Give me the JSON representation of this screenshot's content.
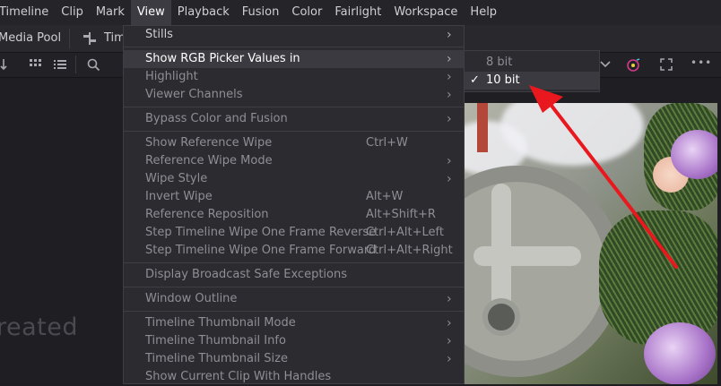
{
  "menubar": {
    "items": [
      "Timeline",
      "Clip",
      "Mark",
      "View",
      "Playback",
      "Fusion",
      "Color",
      "Fairlight",
      "Workspace",
      "Help"
    ],
    "active_index": 3
  },
  "toolbar1": {
    "media_pool_label": "Media Pool",
    "timeline_label_partial": "Tim"
  },
  "left_panel": {
    "empty_text_partial": "reated"
  },
  "view_menu": {
    "items": [
      {
        "label": "Stills",
        "shortcut": "",
        "submenu": true,
        "enabled": true
      },
      {
        "label": "Show RGB Picker Values in",
        "shortcut": "",
        "submenu": true,
        "enabled": true,
        "highlighted": true
      },
      {
        "label": "Highlight",
        "shortcut": "",
        "submenu": true,
        "enabled": false
      },
      {
        "label": "Viewer Channels",
        "shortcut": "",
        "submenu": true,
        "enabled": false
      },
      {
        "label": "Bypass Color and Fusion",
        "shortcut": "",
        "submenu": true,
        "enabled": false
      },
      {
        "label": "Show Reference Wipe",
        "shortcut": "Ctrl+W",
        "submenu": false,
        "enabled": false
      },
      {
        "label": "Reference Wipe Mode",
        "shortcut": "",
        "submenu": true,
        "enabled": false
      },
      {
        "label": "Wipe Style",
        "shortcut": "",
        "submenu": true,
        "enabled": false
      },
      {
        "label": "Invert Wipe",
        "shortcut": "Alt+W",
        "submenu": false,
        "enabled": false
      },
      {
        "label": "Reference Reposition",
        "shortcut": "Alt+Shift+R",
        "submenu": false,
        "enabled": false
      },
      {
        "label": "Step Timeline Wipe One Frame Reverse",
        "shortcut": "Ctrl+Alt+Left",
        "submenu": false,
        "enabled": false
      },
      {
        "label": "Step Timeline Wipe One Frame Forward",
        "shortcut": "Ctrl+Alt+Right",
        "submenu": false,
        "enabled": false
      },
      {
        "label": "Display Broadcast Safe Exceptions",
        "shortcut": "",
        "submenu": false,
        "enabled": false
      },
      {
        "label": "Window Outline",
        "shortcut": "",
        "submenu": true,
        "enabled": false
      },
      {
        "label": "Timeline Thumbnail Mode",
        "shortcut": "",
        "submenu": true,
        "enabled": false
      },
      {
        "label": "Timeline Thumbnail Info",
        "shortcut": "",
        "submenu": true,
        "enabled": false
      },
      {
        "label": "Timeline Thumbnail Size",
        "shortcut": "",
        "submenu": true,
        "enabled": false
      },
      {
        "label": "Show Current Clip With Handles",
        "shortcut": "",
        "submenu": false,
        "enabled": false
      }
    ]
  },
  "rgb_submenu": {
    "items": [
      {
        "label": "8 bit",
        "checked": false
      },
      {
        "label": "10 bit",
        "checked": true
      }
    ],
    "check_glyph": "✓"
  },
  "glyphs": {
    "submenu_arrow": "›",
    "more": "•••"
  },
  "colors": {
    "annotation_arrow": "#e8181e",
    "menu_highlight": "#3a3a40"
  }
}
